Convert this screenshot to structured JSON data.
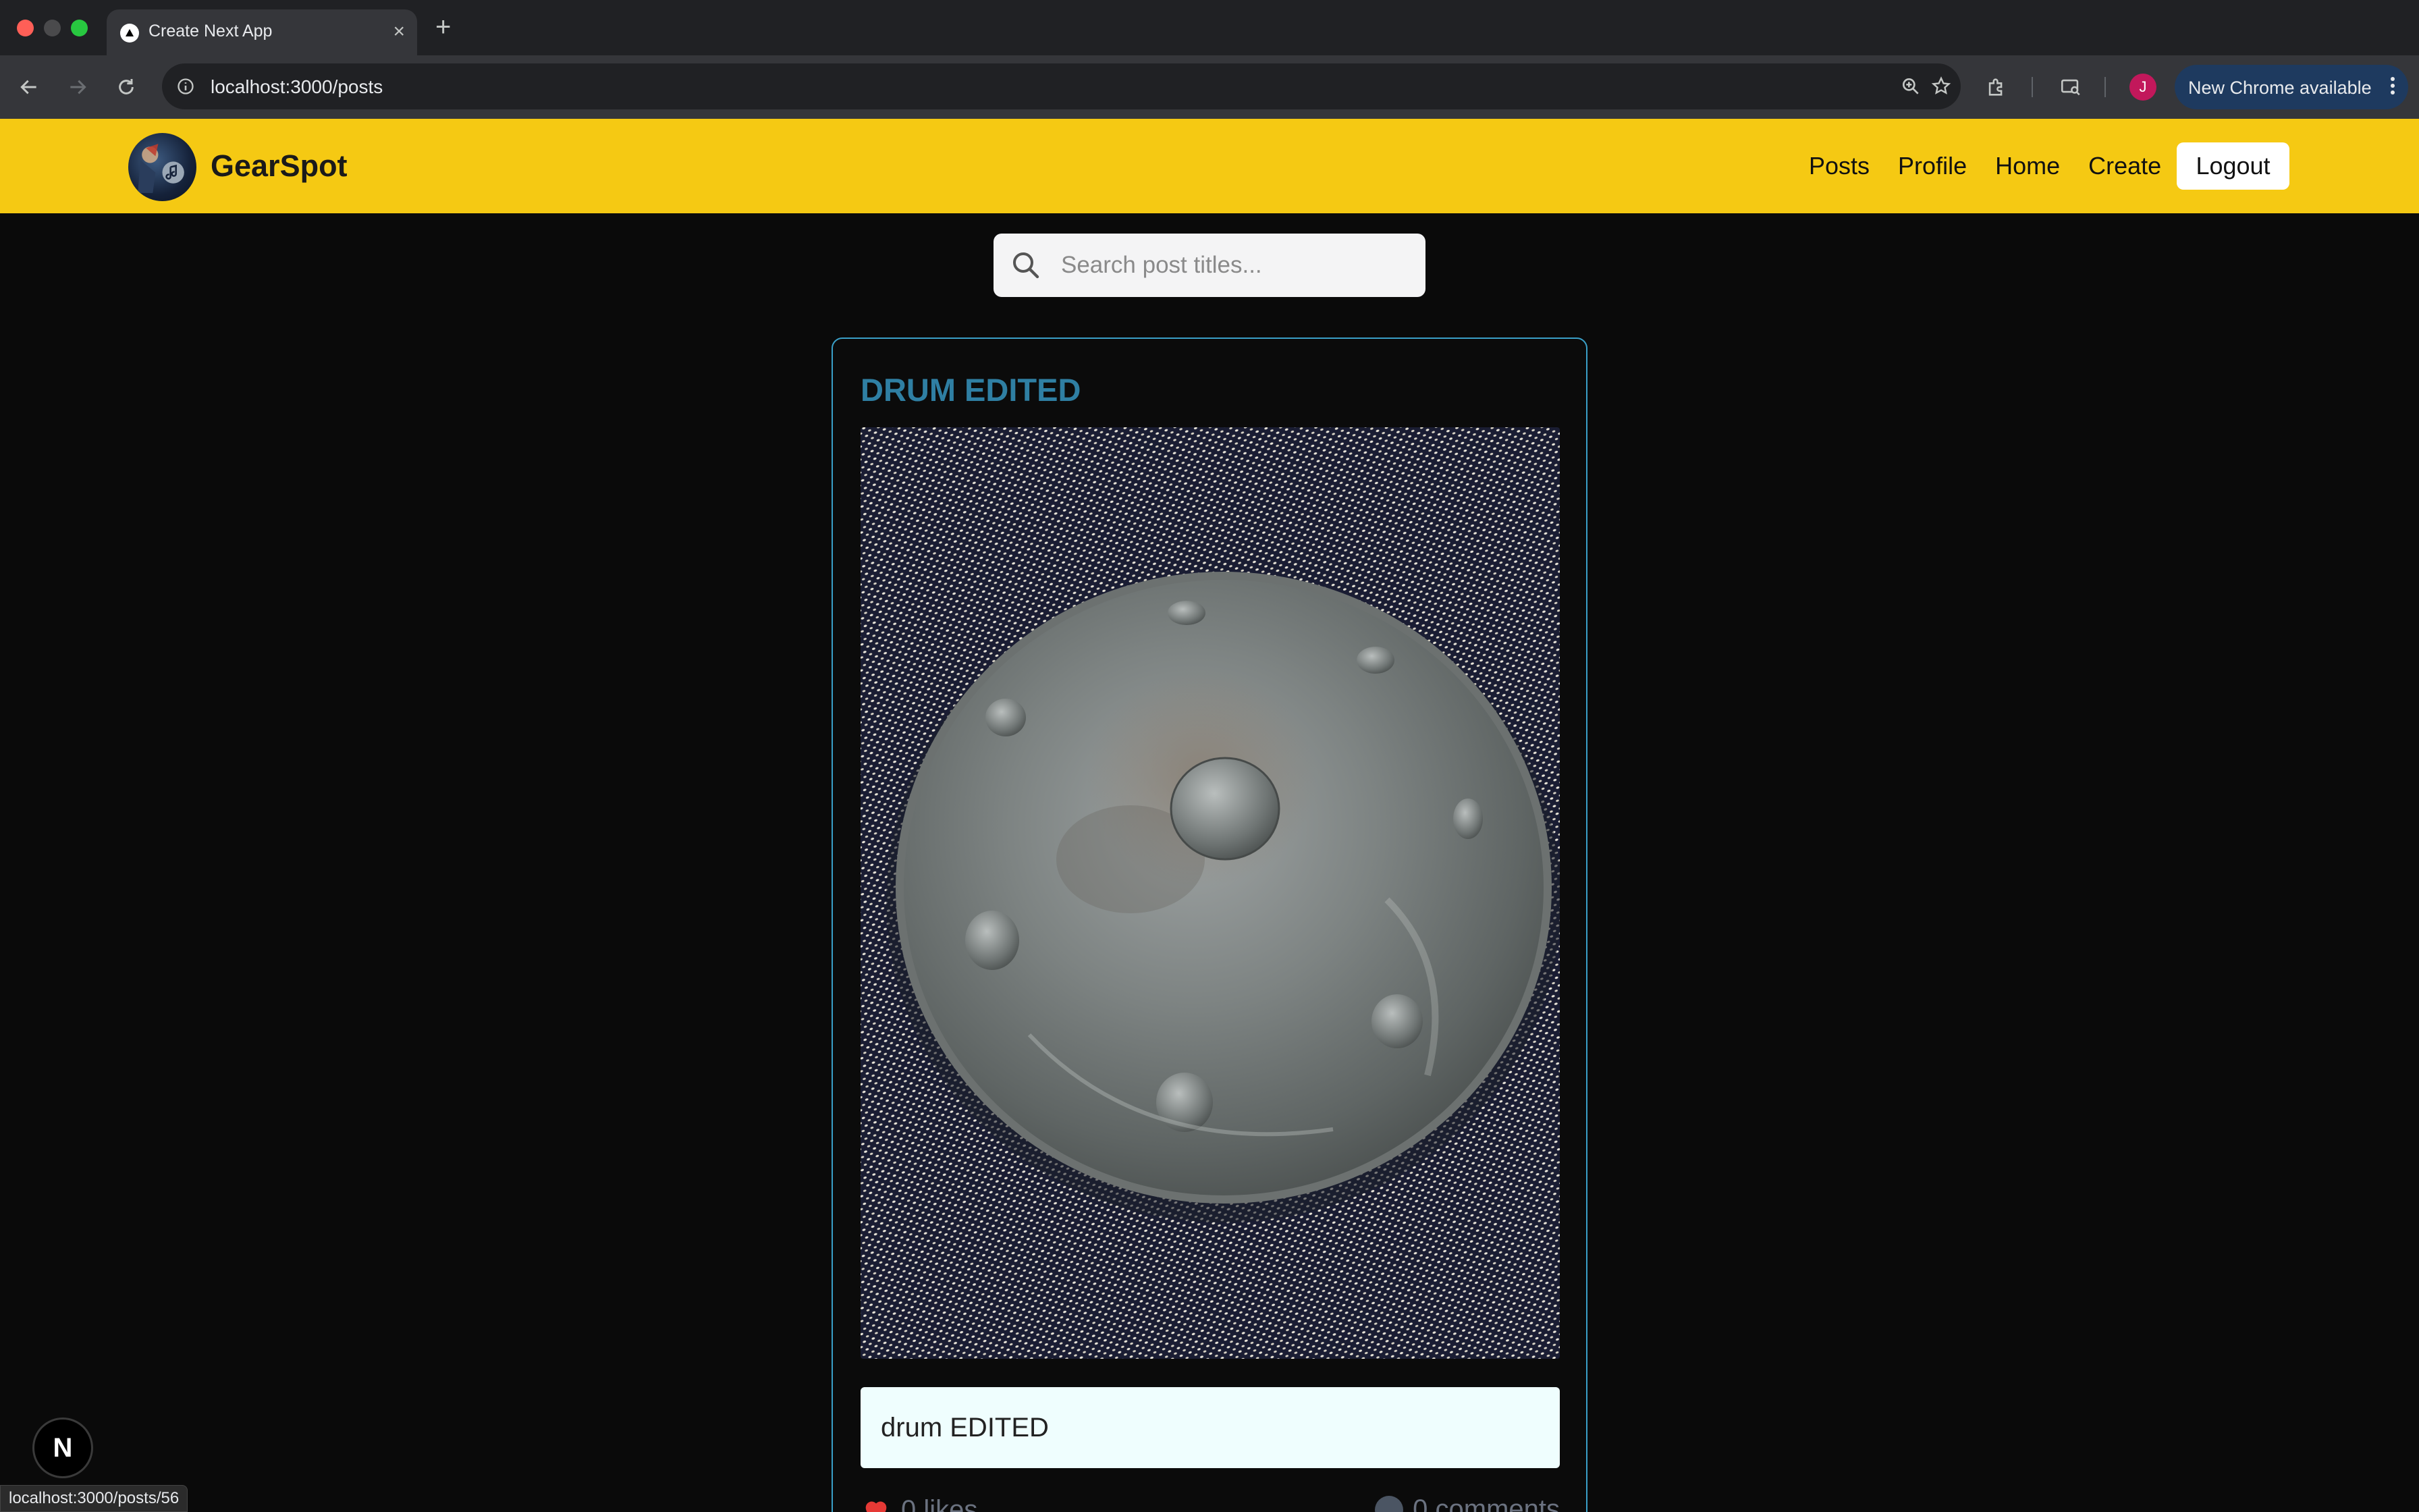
{
  "browser": {
    "tab_title": "Create Next App",
    "url": "localhost:3000/posts",
    "profile_initial": "J",
    "update_label": "New Chrome available",
    "status_url": "localhost:3000/posts/56"
  },
  "header": {
    "brand": "GearSpot",
    "nav": [
      "Posts",
      "Profile",
      "Home",
      "Create"
    ],
    "logout_label": "Logout",
    "accent_color": "#f5c913"
  },
  "search": {
    "placeholder": "Search post titles..."
  },
  "post": {
    "title": "DRUM EDITED",
    "description": "drum EDITED",
    "likes_text": "0 likes",
    "comments_text": "0 comments",
    "image_subject": "handpan-drum-photo",
    "title_color": "#2f7fa3",
    "border_color": "#3aa0c8"
  },
  "dev_badge": {
    "label": "N"
  }
}
